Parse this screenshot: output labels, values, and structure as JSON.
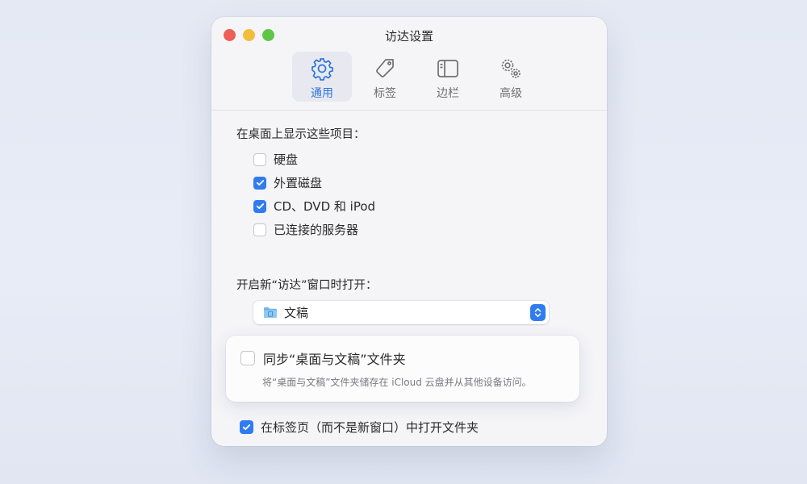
{
  "window": {
    "title": "访达设置"
  },
  "toolbar": {
    "tabs": [
      {
        "label": "通用",
        "icon": "gear-icon",
        "active": true
      },
      {
        "label": "标签",
        "icon": "tag-icon",
        "active": false
      },
      {
        "label": "边栏",
        "icon": "sidebar-icon",
        "active": false
      },
      {
        "label": "高级",
        "icon": "gears-icon",
        "active": false
      }
    ]
  },
  "desktop_section": {
    "label": "在桌面上显示这些项目：",
    "items": [
      {
        "label": "硬盘",
        "checked": false
      },
      {
        "label": "外置磁盘",
        "checked": true
      },
      {
        "label": "CD、DVD 和 iPod",
        "checked": true
      },
      {
        "label": "已连接的服务器",
        "checked": false
      }
    ]
  },
  "new_window_section": {
    "label": "开启新“访达”窗口时打开：",
    "selected": "文稿",
    "selected_icon": "folder-icon"
  },
  "icloud_sync": {
    "label": "同步“桌面与文稿”文件夹",
    "checked": false,
    "description": "将“桌面与文稿”文件夹储存在 iCloud 云盘并从其他设备访问。"
  },
  "tabs_option": {
    "label": "在标签页（而不是新窗口）中打开文件夹",
    "checked": true
  },
  "colors": {
    "accent": "#2f7cf0",
    "active_tab_text": "#2f74da"
  }
}
